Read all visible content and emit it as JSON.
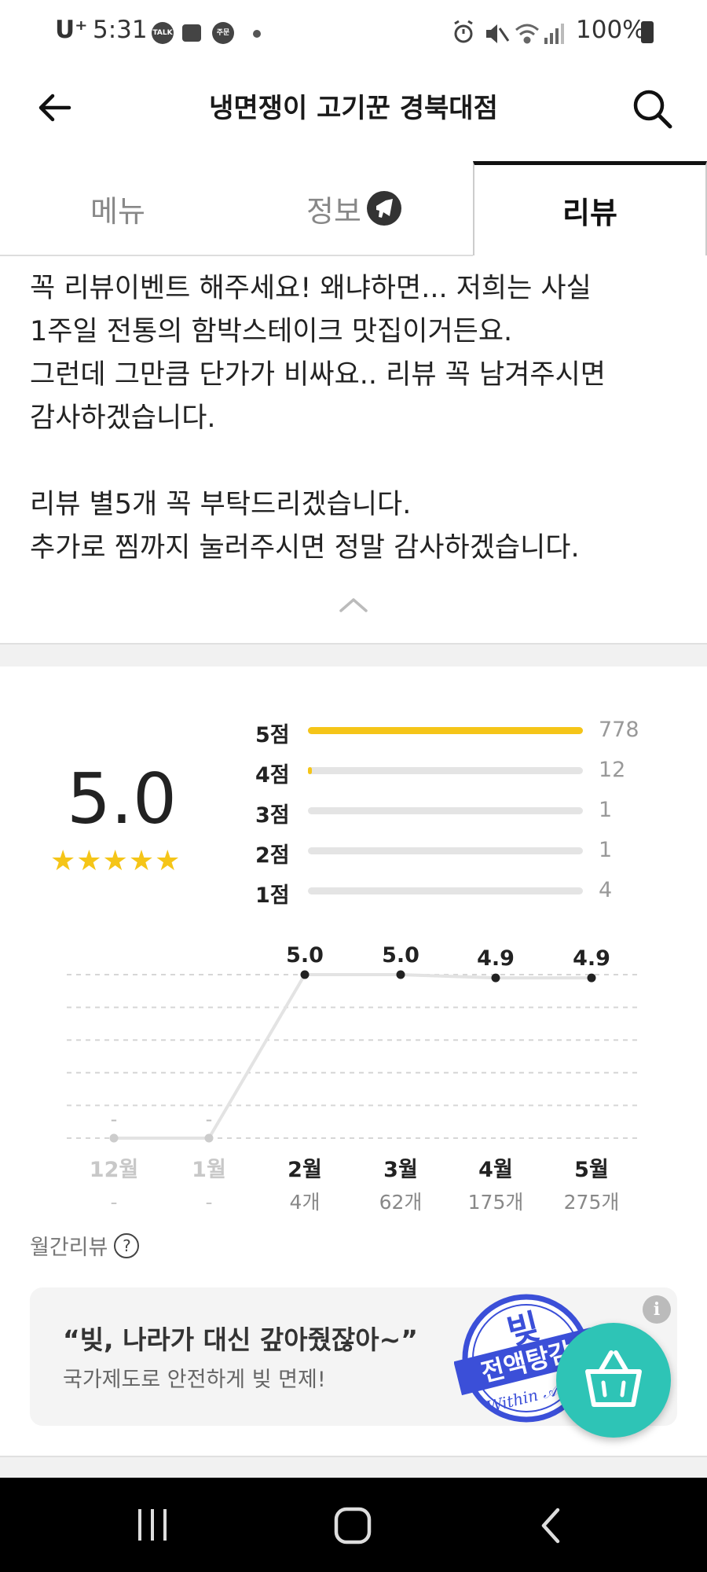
{
  "status_bar": {
    "carrier": "U⁺",
    "time": "5:31",
    "notif_icons": [
      "talk-icon",
      "image-icon",
      "order-icon"
    ],
    "battery": "100%"
  },
  "header": {
    "title": "냉면쟁이 고기꾼 경북대점"
  },
  "tabs": [
    {
      "label": "메뉴",
      "active": false
    },
    {
      "label": "정보",
      "active": false
    },
    {
      "label": "리뷰",
      "active": true
    }
  ],
  "notice": {
    "lines": [
      "꼭 리뷰이벤트 해주세요! 왜냐하면... 저희는 사실",
      "1주일 전통의 함박스테이크 맛집이거든요.",
      "그런데 그만큼 단가가 비싸요.. 리뷰 꼭 남겨주시면",
      "감사하겠습니다.",
      "",
      "리뷰 별5개 꼭 부탁드리겠습니다.",
      "추가로 찜까지 눌러주시면 정말 감사하겠습니다."
    ]
  },
  "rating": {
    "score": "5.0",
    "stars": "★★★★★",
    "accent": "#f5c518",
    "distribution": [
      {
        "label": "5점",
        "count": 778,
        "count_text": "778"
      },
      {
        "label": "4점",
        "count": 12,
        "count_text": "12"
      },
      {
        "label": "3점",
        "count": 1,
        "count_text": "1"
      },
      {
        "label": "2점",
        "count": 1,
        "count_text": "1"
      },
      {
        "label": "1점",
        "count": 4,
        "count_text": "4"
      }
    ]
  },
  "chart_data": {
    "type": "line",
    "categories": [
      "12월",
      "1월",
      "2월",
      "3월",
      "4월",
      "5월"
    ],
    "values": [
      null,
      null,
      5.0,
      5.0,
      4.9,
      4.9
    ],
    "point_labels": [
      "-",
      "-",
      "5.0",
      "5.0",
      "4.9",
      "4.9"
    ],
    "review_counts": [
      "-",
      "-",
      "4개",
      "62개",
      "175개",
      "275개"
    ],
    "grid": true,
    "ylim": [
      0,
      5.0
    ]
  },
  "monthly_label": "월간리뷰",
  "help_icon": "?",
  "banner": {
    "quote": "“빚, 나라가 대신 갚아줬잖아~”",
    "sub": "국가제도로 안전하게 빚 면제!",
    "info": "i",
    "stamp_title": "빚",
    "stamp_sub": "전액탕감",
    "stamp_script": "Within 𝒜"
  },
  "colors": {
    "teal": "#2ec4b6",
    "stamp_blue": "#3b4fd8"
  }
}
